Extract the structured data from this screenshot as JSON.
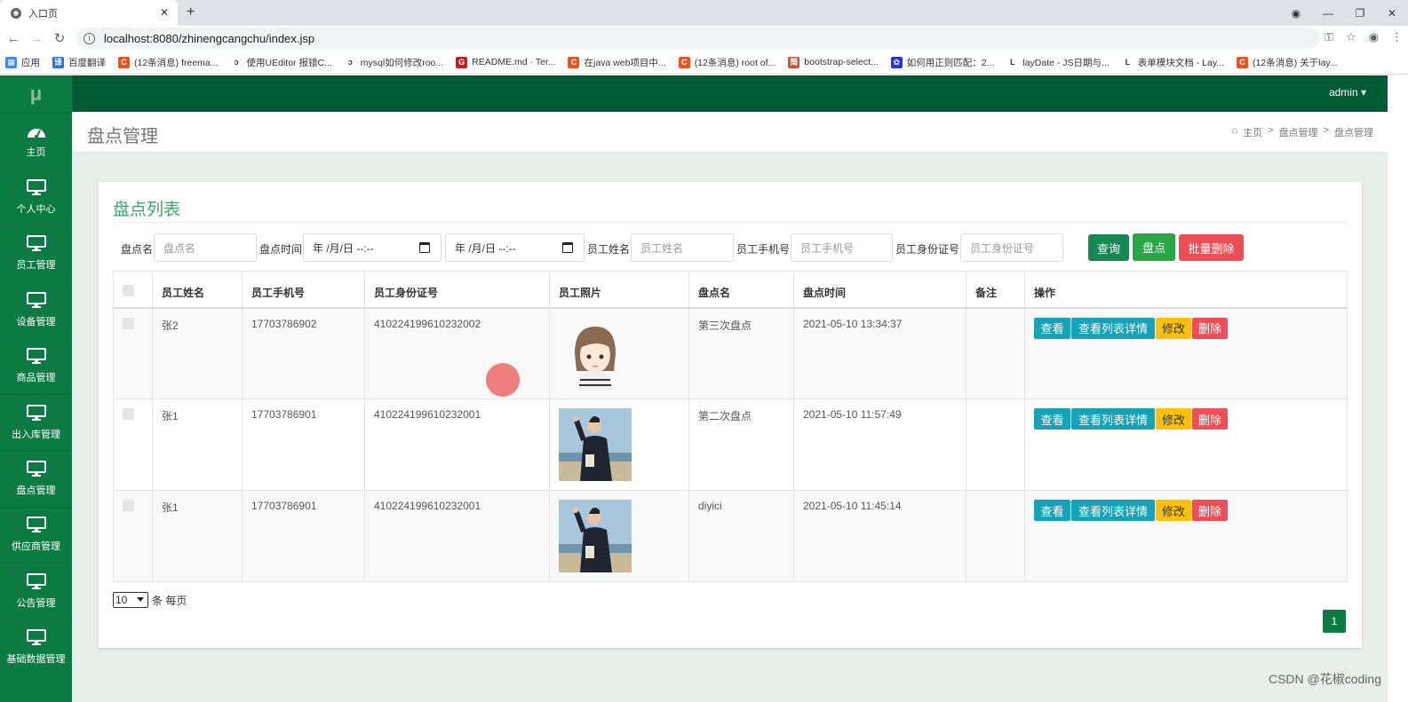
{
  "browser": {
    "tab_title": "入口页",
    "url": "localhost:8080/zhinengcangchu/index.jsp",
    "bookmarks": [
      {
        "label": "应用",
        "color": "#4285f4",
        "glyph": "▦"
      },
      {
        "label": "百度翻译",
        "color": "#2b6de8",
        "glyph": "译"
      },
      {
        "label": "(12条消息) freema...",
        "color": "#e8531f",
        "glyph": "C"
      },
      {
        "label": "使用UEditor 报错C...",
        "color": "#333333",
        "glyph": "ↄ"
      },
      {
        "label": "mysql如何修改roo...",
        "color": "#333333",
        "glyph": "ↄ"
      },
      {
        "label": "README.md · Ter...",
        "color": "#c71d23",
        "glyph": "G"
      },
      {
        "label": "在java web项目中...",
        "color": "#e8531f",
        "glyph": "C"
      },
      {
        "label": "(12条消息) root of...",
        "color": "#e8531f",
        "glyph": "C"
      },
      {
        "label": "bootstrap-select...",
        "color": "#c8572b",
        "glyph": "简"
      },
      {
        "label": "如何用正则匹配：2...",
        "color": "#2932e1",
        "glyph": "✿"
      },
      {
        "label": "layDate - JS日期与...",
        "color": "#333333",
        "glyph": "L"
      },
      {
        "label": "表单模块文档 - Lay...",
        "color": "#333333",
        "glyph": "L"
      },
      {
        "label": "(12条消息) 关于lay...",
        "color": "#e8531f",
        "glyph": "C"
      }
    ]
  },
  "sidebar": {
    "logo": "μ",
    "items": [
      {
        "label": "主页",
        "icon": "dashboard-icon"
      },
      {
        "label": "个人中心",
        "icon": "monitor-icon"
      },
      {
        "label": "员工管理",
        "icon": "monitor-icon"
      },
      {
        "label": "设备管理",
        "icon": "monitor-icon"
      },
      {
        "label": "商品管理",
        "icon": "monitor-icon"
      },
      {
        "label": "出入库管理",
        "icon": "monitor-icon"
      },
      {
        "label": "盘点管理",
        "icon": "monitor-icon"
      },
      {
        "label": "供应商管理",
        "icon": "monitor-icon"
      },
      {
        "label": "公告管理",
        "icon": "monitor-icon"
      },
      {
        "label": "基础数据管理",
        "icon": "monitor-icon"
      }
    ]
  },
  "topbar": {
    "user": "admin ▾"
  },
  "header": {
    "title": "盘点管理",
    "breadcrumb": [
      "主页",
      "盘点管理",
      "盘点管理"
    ]
  },
  "panel": {
    "title": "盘点列表",
    "search": {
      "name_label": "盘点名",
      "name_placeholder": "盘点名",
      "time_label": "盘点时间",
      "date_from": "年 /月/日 --:--",
      "date_to": "年 /月/日 --:--",
      "emp_name_label": "员工姓名",
      "emp_name_placeholder": "员工姓名",
      "phone_label": "员工手机号",
      "phone_placeholder": "员工手机号",
      "idcard_label": "员工身份证号",
      "idcard_placeholder": "员工身份证号",
      "query_button": "查询",
      "check_button": "盘点",
      "batch_delete_button": "批量删除"
    },
    "columns": [
      "员工姓名",
      "员工手机号",
      "员工身份证号",
      "员工照片",
      "盘点名",
      "盘点时间",
      "备注",
      "操作"
    ],
    "rows": [
      {
        "name": "张2",
        "phone": "17703786902",
        "idcard": "410224199610232002",
        "photo": "cartoon-girl",
        "check_name": "第三次盘点",
        "time": "2021-05-10 13:34:37",
        "note": ""
      },
      {
        "name": "张1",
        "phone": "17703786901",
        "idcard": "410224199610232001",
        "photo": "man-jacket",
        "check_name": "第二次盘点",
        "time": "2021-05-10 11:57:49",
        "note": ""
      },
      {
        "name": "张1",
        "phone": "17703786901",
        "idcard": "410224199610232001",
        "photo": "man-jacket",
        "check_name": "diyici",
        "time": "2021-05-10 11:45:14",
        "note": ""
      }
    ],
    "row_actions": {
      "view": "查看",
      "view_detail": "查看列表详情",
      "edit": "修改",
      "delete": "删除"
    },
    "pagination": {
      "page_size": "10",
      "per_page_label": "条 每页",
      "current_page": "1"
    }
  },
  "watermark": "CSDN @花椒coding",
  "colors": {
    "sidebar": "#0b7a43",
    "topbar": "#005a34",
    "info": "#17a2b8",
    "warning": "#ffc107",
    "danger": "#f04e57",
    "success": "#28a745"
  }
}
